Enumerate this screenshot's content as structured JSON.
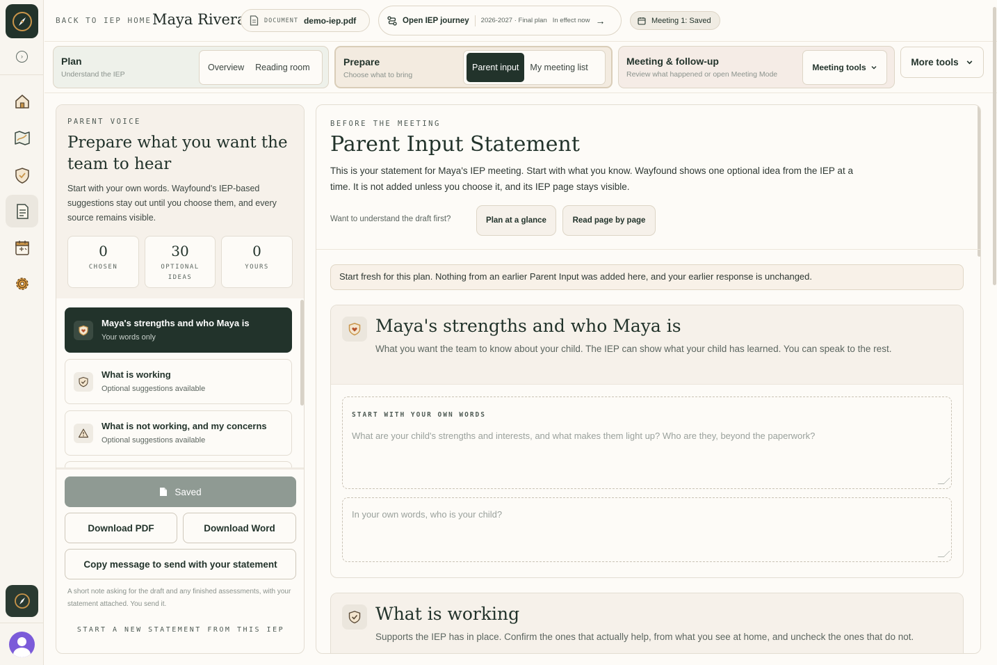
{
  "rail": {
    "items": [
      {
        "icon": "home-icon"
      },
      {
        "icon": "map-icon"
      },
      {
        "icon": "shield-icon"
      },
      {
        "icon": "document-icon"
      },
      {
        "icon": "calendar-icon"
      },
      {
        "icon": "gear-icon"
      }
    ]
  },
  "topbar": {
    "back_label": "BACK TO IEP HOME",
    "student_name": "Maya Rivera",
    "document_label": "DOCUMENT",
    "document_name": "demo-iep.pdf",
    "journey_label": "Open IEP journey",
    "journey_meta": "2026-2027 · Final plan",
    "journey_status": "In effect now",
    "meeting_status": "Meeting 1: Saved"
  },
  "stages": {
    "plan": {
      "title": "Plan",
      "subtitle": "Understand the IEP",
      "tabs": [
        "Overview",
        "Reading room"
      ]
    },
    "prepare": {
      "title": "Prepare",
      "subtitle": "Choose what to bring",
      "tabs": [
        "Parent input",
        "My meeting list"
      ],
      "active_tab": "Parent input"
    },
    "meeting": {
      "title": "Meeting & follow-up",
      "subtitle": "Review what happened or open Meeting Mode",
      "tools_label": "Meeting tools"
    },
    "more_tools": "More tools"
  },
  "left_panel": {
    "eyebrow": "PARENT VOICE",
    "title": "Prepare what you want the team to hear",
    "description": "Start with your own words. Wayfound's IEP-based suggestions stay out until you choose them, and every source remains visible.",
    "stats": [
      {
        "value": "0",
        "label": "CHOSEN"
      },
      {
        "value": "30",
        "label": "OPTIONAL IDEAS"
      },
      {
        "value": "0",
        "label": "YOURS"
      }
    ],
    "sections": [
      {
        "title": "Maya's strengths and who Maya is",
        "subtitle": "Your words only",
        "icon": "heart-shield-icon"
      },
      {
        "title": "What is working",
        "subtitle": "Optional suggestions available",
        "icon": "check-shield-icon"
      },
      {
        "title": "What is not working, and my concerns",
        "subtitle": "Optional suggestions available",
        "icon": "warning-icon"
      }
    ],
    "saved_label": "Saved",
    "download_pdf": "Download PDF",
    "download_word": "Download Word",
    "copy_message": "Copy message to send with your statement",
    "note": "A short note asking for the draft and any finished assessments, with your statement attached. You send it.",
    "restart": "START A NEW STATEMENT FROM THIS IEP"
  },
  "main": {
    "eyebrow": "BEFORE THE MEETING",
    "title": "Parent Input Statement",
    "description": "This is your statement for Maya's IEP meeting. Start with what you know. Wayfound shows one optional idea from the IEP at a time. It is not added unless you choose it, and its IEP page stays visible.",
    "understand_prompt": "Want to understand the draft first?",
    "chip_glance": "Plan at a glance",
    "chip_page": "Read page by page",
    "notice": "Start fresh for this plan. Nothing from an earlier Parent Input was added here, and your earlier response is unchanged.",
    "card1": {
      "title": "Maya's strengths and who Maya is",
      "description": "What you want the team to know about your child. The IEP can show what your child has learned. You can speak to the rest.",
      "field_label": "START WITH YOUR OWN WORDS",
      "field1_placeholder": "What are your child's strengths and interests, and what makes them light up? Who are they, beyond the paperwork?",
      "field2_placeholder": "In your own words, who is your child?"
    },
    "card2": {
      "title": "What is working",
      "description": "Supports the IEP has in place. Confirm the ones that actually help, from what you see at home, and uncheck the ones that do not."
    }
  },
  "colors": {
    "brand_dark": "#22332b",
    "accent_gold": "#c9954a",
    "background": "#fdfbf7"
  }
}
